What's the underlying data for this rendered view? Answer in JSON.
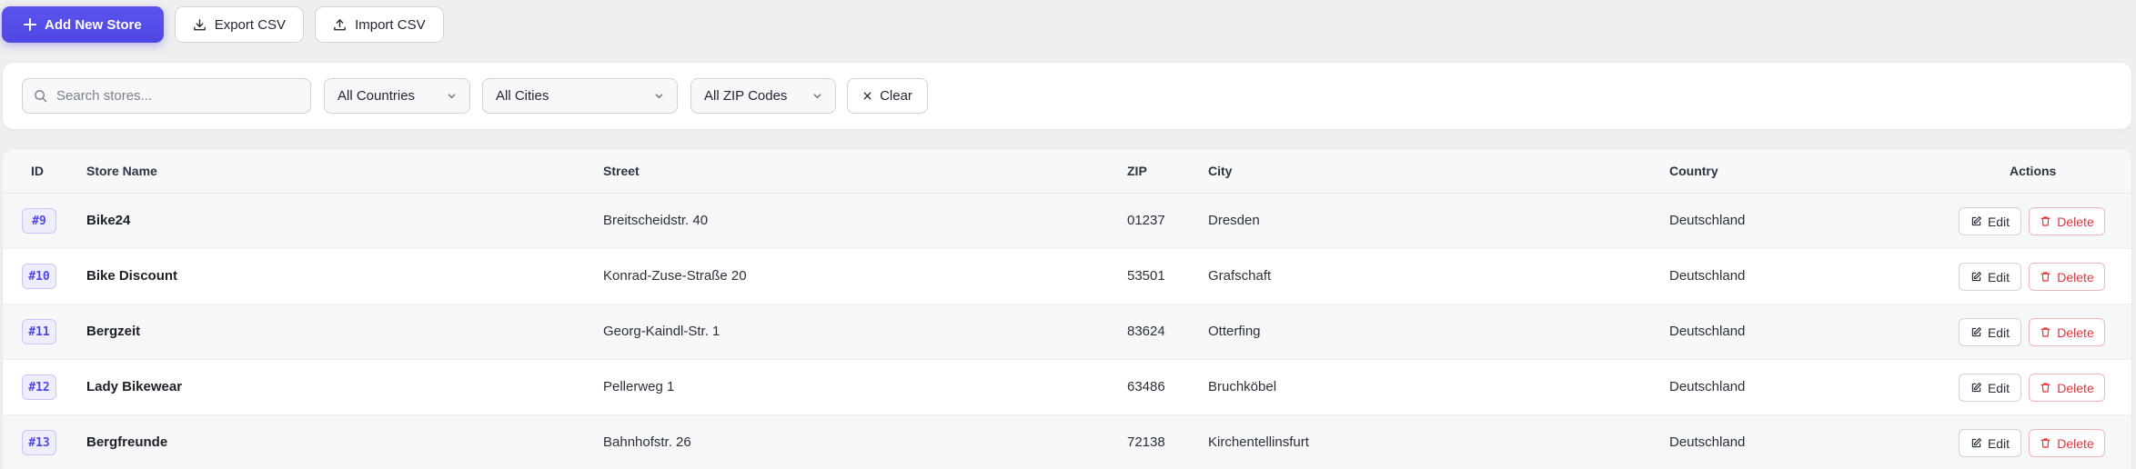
{
  "toolbar": {
    "add_label": "Add New Store",
    "export_label": "Export CSV",
    "import_label": "Import CSV"
  },
  "filters": {
    "search_placeholder": "Search stores...",
    "country": "All Countries",
    "city": "All Cities",
    "zip": "All ZIP Codes",
    "clear_label": "Clear"
  },
  "table": {
    "headers": {
      "id": "ID",
      "name": "Store Name",
      "street": "Street",
      "zip": "ZIP",
      "city": "City",
      "country": "Country",
      "actions": "Actions"
    },
    "rows": [
      {
        "id": "#9",
        "name": "Bike24",
        "street": "Breitscheidstr. 40",
        "zip": "01237",
        "city": "Dresden",
        "country": "Deutschland",
        "edit": "Edit",
        "delete": "Delete"
      },
      {
        "id": "#10",
        "name": "Bike Discount",
        "street": "Konrad-Zuse-Straße 20",
        "zip": "53501",
        "city": "Grafschaft",
        "country": "Deutschland",
        "edit": "Edit",
        "delete": "Delete"
      },
      {
        "id": "#11",
        "name": "Bergzeit",
        "street": "Georg-Kaindl-Str. 1",
        "zip": "83624",
        "city": "Otterfing",
        "country": "Deutschland",
        "edit": "Edit",
        "delete": "Delete"
      },
      {
        "id": "#12",
        "name": "Lady Bikewear",
        "street": "Pellerweg 1",
        "zip": "63486",
        "city": "Bruchköbel",
        "country": "Deutschland",
        "edit": "Edit",
        "delete": "Delete"
      },
      {
        "id": "#13",
        "name": "Bergfreunde",
        "street": "Bahnhofstr. 26",
        "zip": "72138",
        "city": "Kirchentellinsfurt",
        "country": "Deutschland",
        "edit": "Edit",
        "delete": "Delete"
      }
    ]
  },
  "colors": {
    "primary": "#4f47e3",
    "danger": "#e0353a",
    "background": "#efefef"
  },
  "icons": {
    "add": "plus-icon",
    "export": "download-icon",
    "import": "upload-icon",
    "search": "search-icon",
    "dropdown": "chevron-down-icon",
    "clear": "close-icon",
    "edit": "edit-icon",
    "delete": "trash-icon"
  }
}
